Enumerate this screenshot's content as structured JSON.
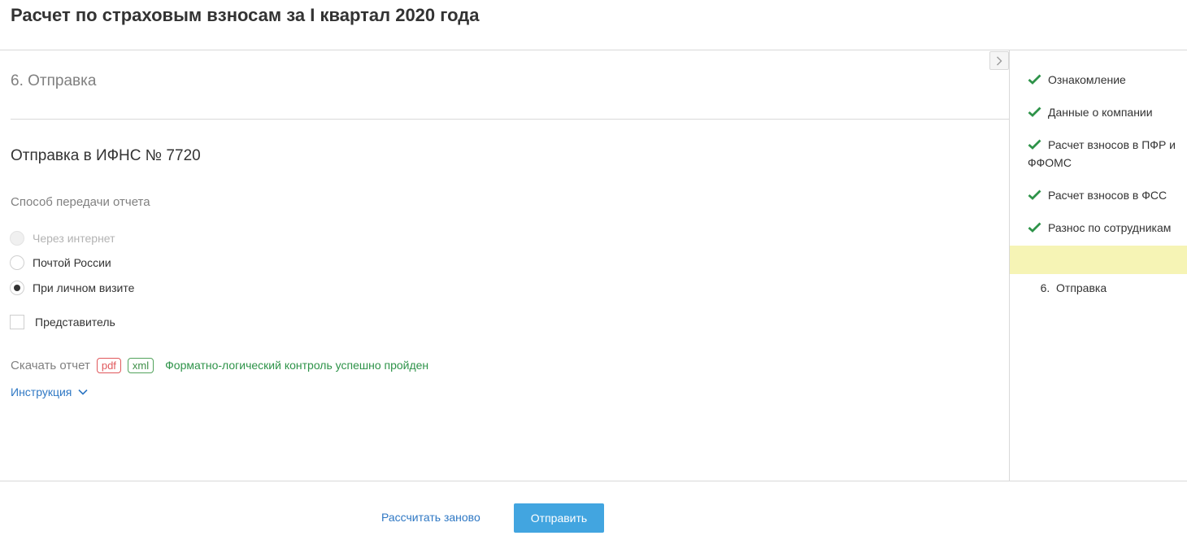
{
  "header": {
    "title": "Расчет по страховым взносам за I квартал 2020 года"
  },
  "main": {
    "step_heading": "6. Отправка",
    "section_title": "Отправка в ИФНС № 7720",
    "method_label": "Способ передачи отчета",
    "methods": [
      {
        "label": "Через интернет",
        "state": "disabled"
      },
      {
        "label": "Почтой России",
        "state": "unchecked"
      },
      {
        "label": "При личном визите",
        "state": "checked"
      }
    ],
    "representative_label": "Представитель",
    "download_label": "Скачать отчет",
    "download_pdf": "pdf",
    "download_xml": "xml",
    "flk_status": "Форматно-логический контроль успешно пройден",
    "instruction_label": "Инструкция"
  },
  "sidebar": {
    "items": [
      {
        "label": "Ознакомление",
        "done": true
      },
      {
        "label": "Данные о компании",
        "done": true
      },
      {
        "label": "Расчет взносов в ПФР и ФФОМС",
        "done": true
      },
      {
        "label": "Расчет взносов в ФСС",
        "done": true
      },
      {
        "label": "Разнос по сотрудникам",
        "done": true
      },
      {
        "label": "6.  Отправка",
        "done": false,
        "active": true
      }
    ]
  },
  "footer": {
    "recalc_label": "Рассчитать заново",
    "send_label": "Отправить"
  },
  "colors": {
    "accent": "#42a5e0",
    "link": "#2f78c4",
    "success": "#2e9349",
    "pdf": "#e0575b",
    "active_step": "#f6f4b5"
  },
  "icons": {
    "check": "check-icon",
    "chevron": "chevron-down-icon",
    "collapse": "chevron-right-icon"
  }
}
